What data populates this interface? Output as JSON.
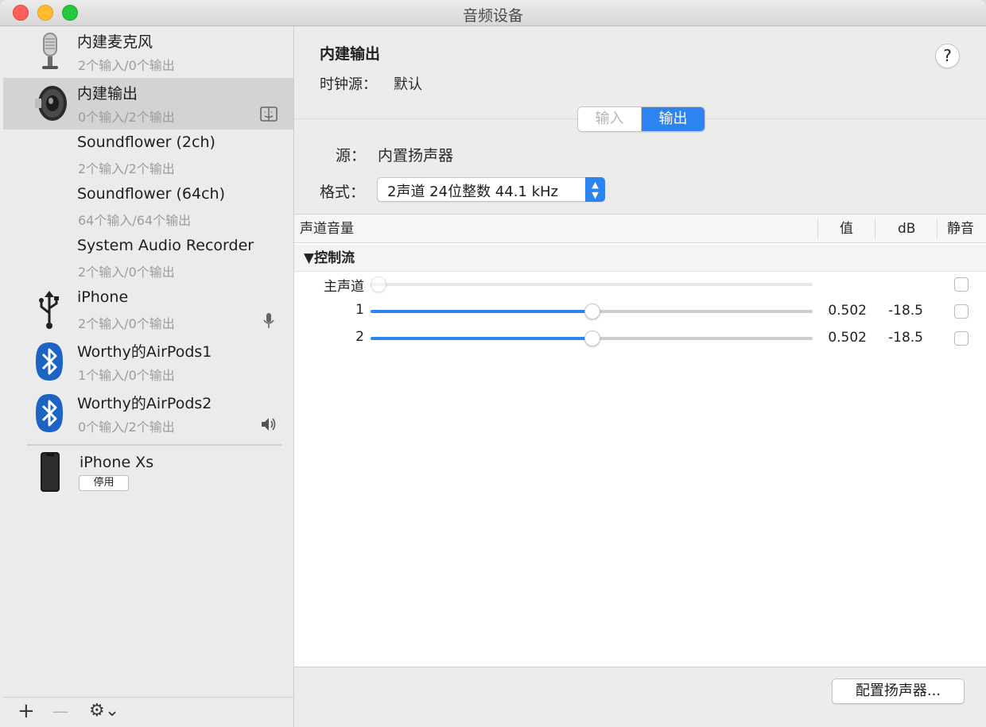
{
  "window": {
    "title": "音频设备"
  },
  "devices": [
    {
      "name": "内建麦克风",
      "sub": "2个输入/0个输出",
      "icon": "microphone-icon"
    },
    {
      "name": "内建输出",
      "sub": "0个输入/2个输出",
      "icon": "speaker-icon",
      "badge": "finder-icon",
      "selected": true
    },
    {
      "name": "Soundflower (2ch)",
      "sub": "2个输入/2个输出"
    },
    {
      "name": "Soundflower (64ch)",
      "sub": "64个输入/64个输出"
    },
    {
      "name": "System Audio Recorder",
      "sub": "2个输入/0个输出"
    },
    {
      "name": "iPhone",
      "sub": "2个输入/0个输出",
      "icon": "usb-icon",
      "badge": "microphone-badge-icon"
    },
    {
      "name": "Worthy的AirPods1",
      "sub": "1个输入/0个输出",
      "icon": "bluetooth-icon"
    },
    {
      "name": "Worthy的AirPods2",
      "sub": "0个输入/2个输出",
      "icon": "bluetooth-icon",
      "badge": "volume-icon"
    }
  ],
  "iphone_xs": {
    "name": "iPhone Xs",
    "button": "停用",
    "icon": "iphone-icon"
  },
  "footer": {
    "add": "+",
    "remove": "—",
    "gear": "⚙︎⌄"
  },
  "detail": {
    "title": "内建输出",
    "clock_label": "时钟源：",
    "clock_value": "默认",
    "help": "?",
    "tabs": {
      "input": "输入",
      "output": "输出",
      "selected": "output"
    },
    "source_label": "源：",
    "source_value": "内置扬声器",
    "format_label": "格式：",
    "format_value": "2声道 24位整数 44.1 kHz",
    "table": {
      "headers": {
        "channel": "声道音量",
        "value": "值",
        "db": "dB",
        "mute": "静音"
      },
      "group": "▼控制流",
      "rows": [
        {
          "label": "主声道",
          "level": 0.0,
          "value": "",
          "db": "",
          "muted": false,
          "enabled": false
        },
        {
          "label": "1",
          "level": 0.502,
          "value": "0.502",
          "db": "-18.5",
          "muted": false,
          "enabled": true
        },
        {
          "label": "2",
          "level": 0.502,
          "value": "0.502",
          "db": "-18.5",
          "muted": false,
          "enabled": true
        }
      ]
    },
    "configure_button": "配置扬声器..."
  },
  "colors": {
    "accent": "#2d84f0",
    "selection": "#d3d3d3"
  }
}
